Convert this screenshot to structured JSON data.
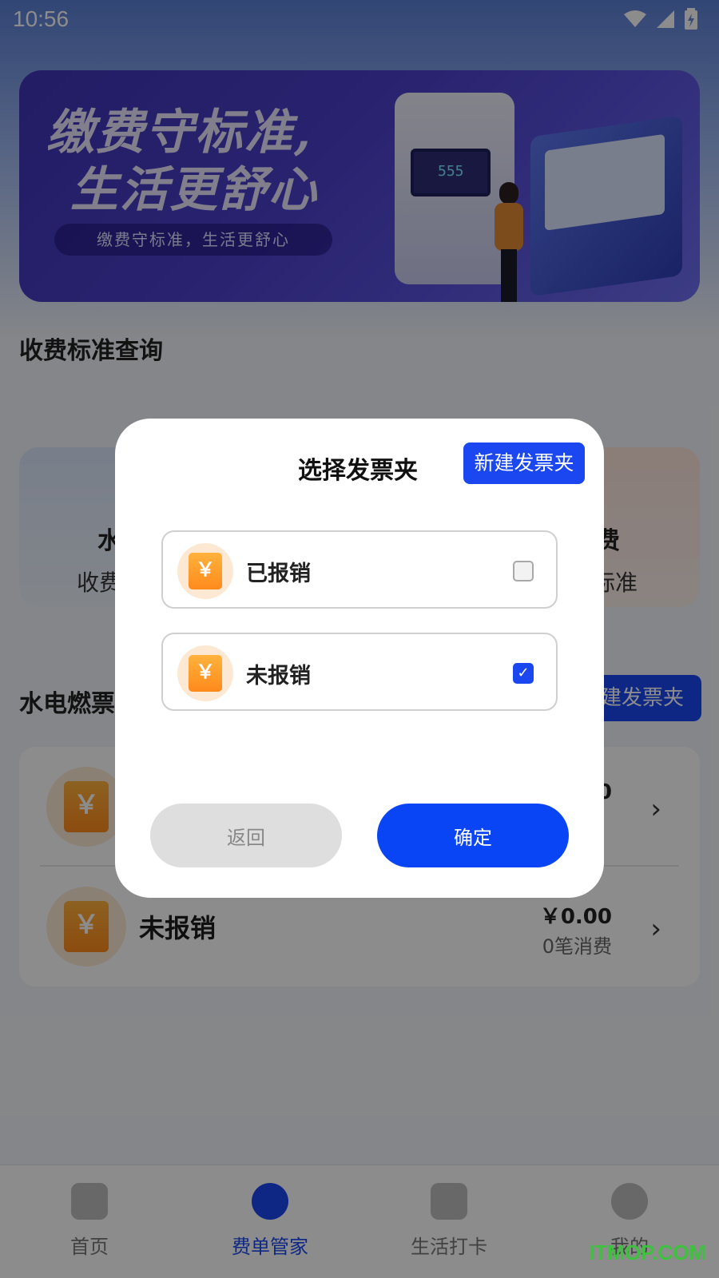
{
  "status_bar": {
    "time": "10:56",
    "icons": [
      "wifi-icon",
      "signal-icon",
      "battery-icon"
    ]
  },
  "banner": {
    "title_line1": "缴费守标准,",
    "title_line2": "生活更舒心",
    "subtitle": "缴费守标准，生活更舒心",
    "meter_reading": "555"
  },
  "sections": {
    "fee_query_title": "收费标准查询",
    "invoice_title_partial": "水电燃票"
  },
  "fee_cards": {
    "water": {
      "name": "水",
      "sub": "收费"
    },
    "gas": {
      "name": "费",
      "sub": "标准"
    }
  },
  "background_new_folder_label": "建发票夹",
  "invoice_list": [
    {
      "name": "",
      "amount": "0",
      "count": ""
    },
    {
      "name": "未报销",
      "amount": "￥0.00",
      "count": "0笔消费"
    }
  ],
  "icon_symbol": "￥",
  "tabbar": {
    "tabs": [
      {
        "label": "首页",
        "icon": "home-icon",
        "active": false
      },
      {
        "label": "费单管家",
        "icon": "butler-icon",
        "active": true
      },
      {
        "label": "生活打卡",
        "icon": "calendar-check-icon",
        "active": false
      },
      {
        "label": "我的",
        "icon": "profile-icon",
        "active": false
      }
    ]
  },
  "watermark": "ITMOP.COM",
  "dialog": {
    "title": "选择发票夹",
    "new_folder_button": "新建发票夹",
    "options": [
      {
        "label": "已报销",
        "checked": false
      },
      {
        "label": "未报销",
        "checked": true
      }
    ],
    "back_button": "返回",
    "confirm_button": "确定"
  },
  "colors": {
    "primary": "#1a47f0",
    "confirm": "#0a45f5",
    "accent_orange": "#ff8a1c"
  }
}
